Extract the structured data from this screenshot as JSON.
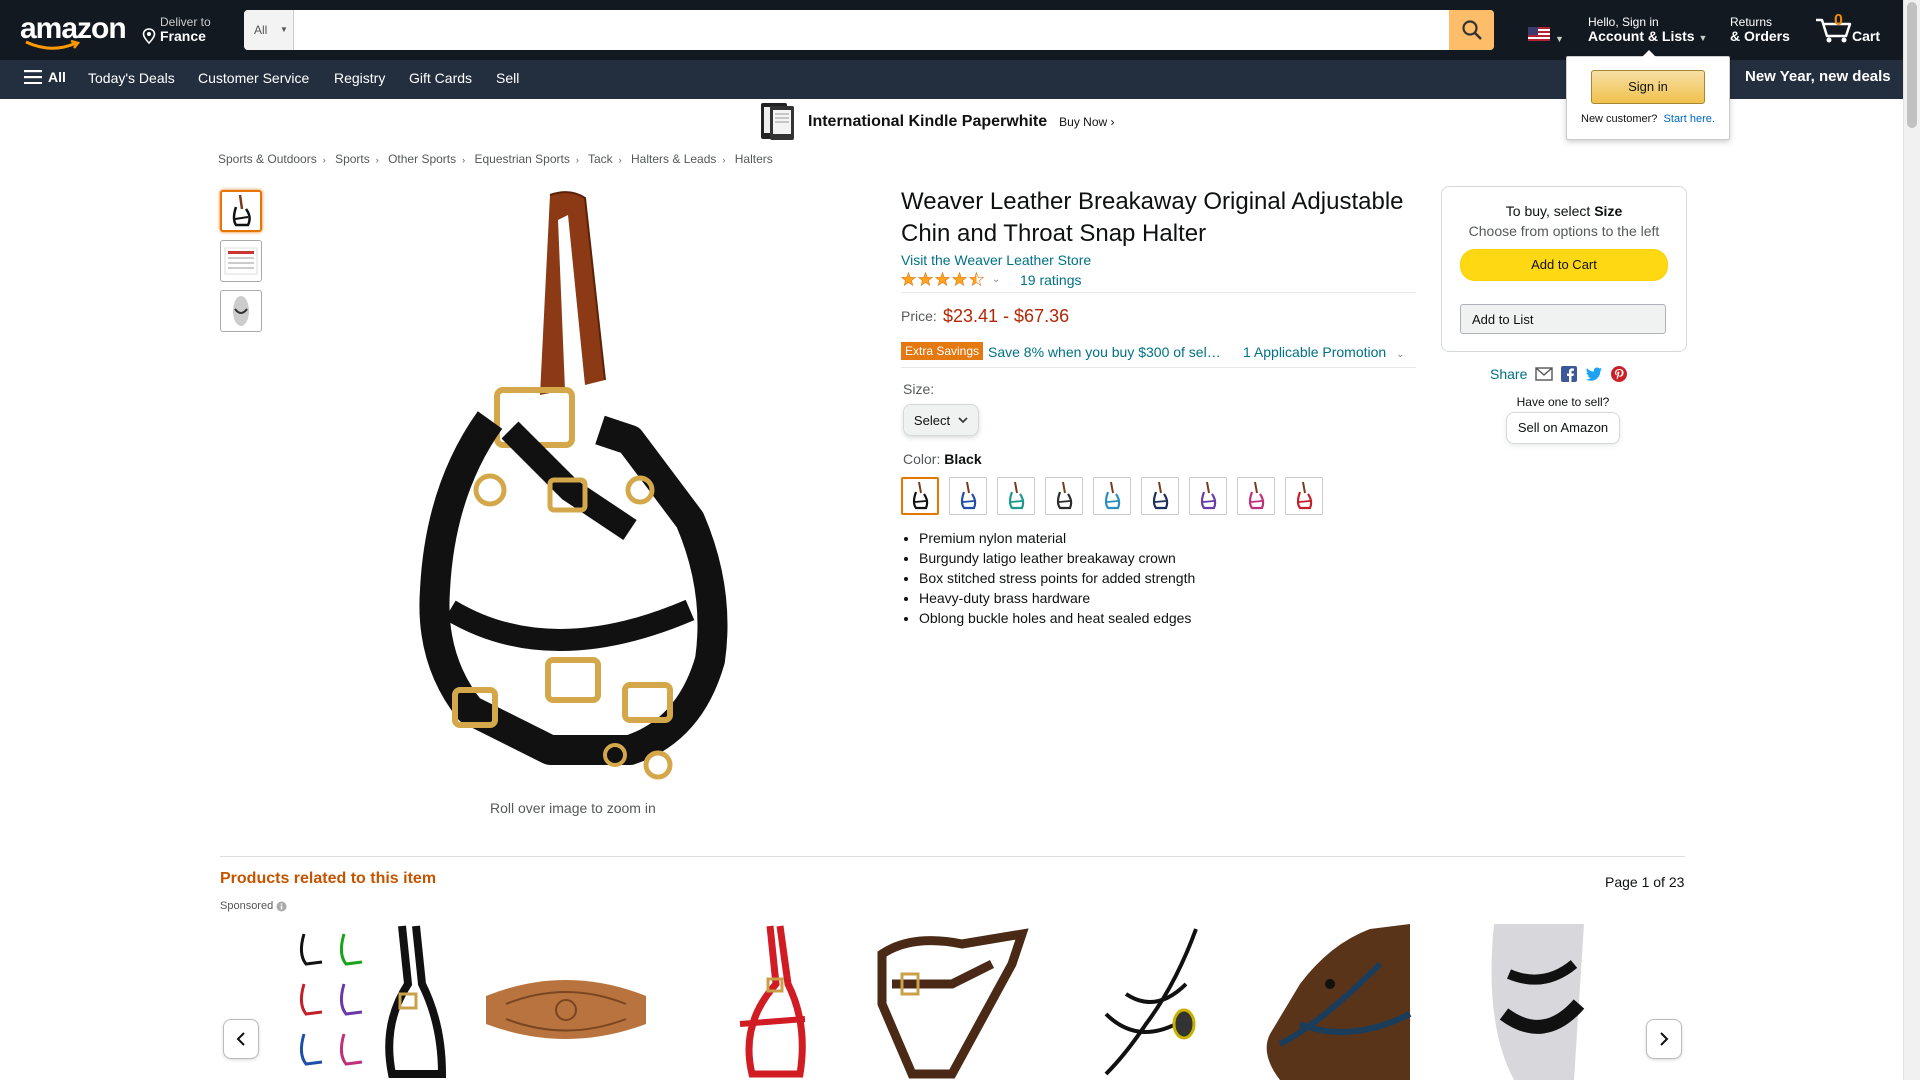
{
  "header": {
    "logo_text": "amazon",
    "deliver_to_label": "Deliver to",
    "deliver_to_location": "France",
    "search": {
      "category": "All",
      "placeholder": "",
      "value": ""
    },
    "account_greeting": "Hello, Sign in",
    "account_label": "Account & Lists",
    "returns_label": "Returns",
    "orders_label": "& Orders",
    "cart_count": "0",
    "cart_label": "Cart"
  },
  "subnav": {
    "all_label": "All",
    "items": [
      "Today's Deals",
      "Customer Service",
      "Registry",
      "Gift Cards",
      "Sell"
    ],
    "promo": "New Year, new deals"
  },
  "signin_popover": {
    "button": "Sign in",
    "new_customer": "New customer?",
    "start_here": "Start here."
  },
  "banner": {
    "title": "International Kindle Paperwhite",
    "cta": "Buy Now ›"
  },
  "breadcrumb": [
    "Sports & Outdoors",
    "Sports",
    "Other Sports",
    "Equestrian Sports",
    "Tack",
    "Halters & Leads",
    "Halters"
  ],
  "gallery": {
    "zoom_hint": "Roll over image to zoom in"
  },
  "product": {
    "title": "Weaver Leather Breakaway Original Adjustable Chin and Throat Snap Halter",
    "store_link": "Visit the Weaver Leather Store",
    "rating_out_of_5": 4.5,
    "ratings_count": "19 ratings",
    "price_label": "Price:",
    "price_range": "$23.41 - $67.36",
    "savings_badge": "Extra Savings",
    "savings_text": "Save 8% when you buy $300 of sele…",
    "promotion_text": "1 Applicable Promotion",
    "size_label": "Size:",
    "size_select": "Select",
    "color_label": "Color:",
    "color_value": "Black",
    "swatch_colors": [
      "#111111",
      "#1f4fa8",
      "#1a9a8a",
      "#2b2b2b",
      "#2a8fbf",
      "#1c2e5a",
      "#6a3aa8",
      "#c0307a",
      "#c4202a"
    ],
    "bullets": [
      "Premium nylon material",
      "Burgundy latigo leather breakaway crown",
      "Box stitched stress points for added strength",
      "Heavy-duty brass hardware",
      "Oblong buckle holes and heat sealed edges"
    ]
  },
  "buybox": {
    "to_buy_prefix": "To buy, select ",
    "to_buy_emphasis": "Size",
    "choose_text": "Choose from options to the left",
    "add_to_cart": "Add to Cart",
    "add_to_list": "Add to List",
    "share_label": "Share",
    "have_one": "Have one to sell?",
    "sell_on_amazon": "Sell on Amazon"
  },
  "related": {
    "title": "Products related to this item",
    "page_info": "Page 1 of 23",
    "sponsored": "Sponsored"
  },
  "colors": {
    "topbar": "#131921",
    "subnav": "#232f3e",
    "accent_orange": "#febd69",
    "price_red": "#b12704",
    "link_teal": "#007185",
    "add_to_cart_yellow": "#ffd814"
  }
}
